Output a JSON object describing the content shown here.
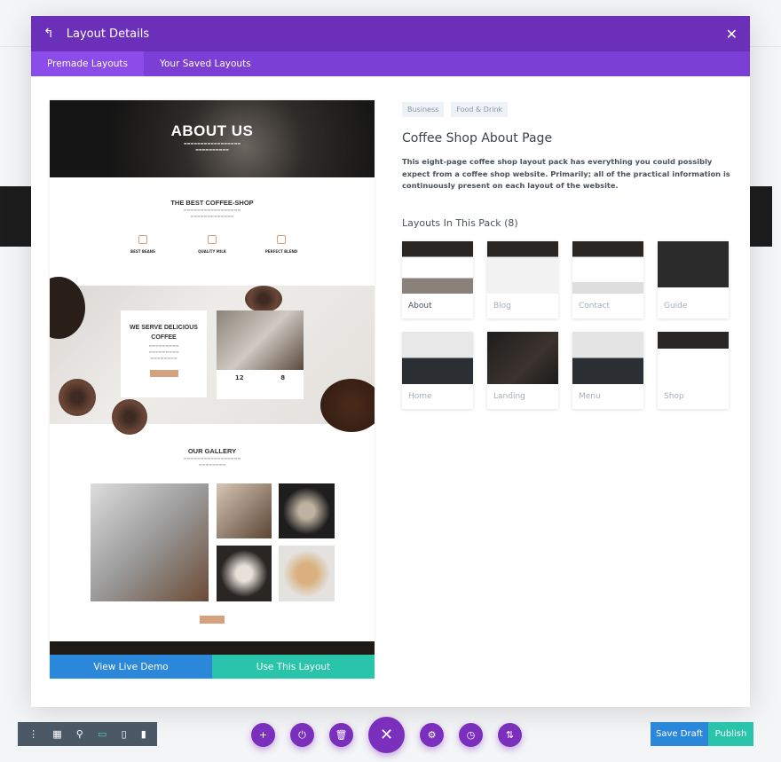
{
  "modal": {
    "title": "Layout Details",
    "back_icon": "undo-arrow-icon",
    "close_icon": "close-icon",
    "tabs": [
      {
        "label": "Premade Layouts",
        "active": true
      },
      {
        "label": "Your Saved Layouts",
        "active": false
      }
    ]
  },
  "preview": {
    "hero_title": "ABOUT US",
    "section1_title": "THE BEST COFFEE-SHOP",
    "features": [
      "BEST BEANS",
      "QUALITY MILK",
      "PERFECT BLEND"
    ],
    "serve_title": "WE SERVE DELICIOUS COFFEE",
    "stats": [
      "12",
      "8"
    ],
    "gallery_title": "OUR GALLERY",
    "view_demo": "View Live Demo",
    "use_layout": "Use This Layout"
  },
  "info": {
    "tags": [
      "Business",
      "Food & Drink"
    ],
    "title": "Coffee Shop About Page",
    "description": "This eight-page coffee shop layout pack has everything you could possibly expect from a coffee shop website. Primarily; all of the practical information is continuously present on each layout of the website.",
    "pack_heading": "Layouts In This Pack (8)",
    "layouts": [
      {
        "label": "About",
        "selected": true
      },
      {
        "label": "Blog"
      },
      {
        "label": "Contact"
      },
      {
        "label": "Guide"
      },
      {
        "label": "Home"
      },
      {
        "label": "Landing"
      },
      {
        "label": "Menu"
      },
      {
        "label": "Shop"
      }
    ]
  },
  "toolbar": {
    "save_draft": "Save Draft",
    "publish": "Publish"
  },
  "colors": {
    "header": "#6b2fba",
    "tabs": "#7c3fd6",
    "demo": "#2b87da",
    "use": "#29c4a9",
    "fab": "#7a2fbd"
  }
}
